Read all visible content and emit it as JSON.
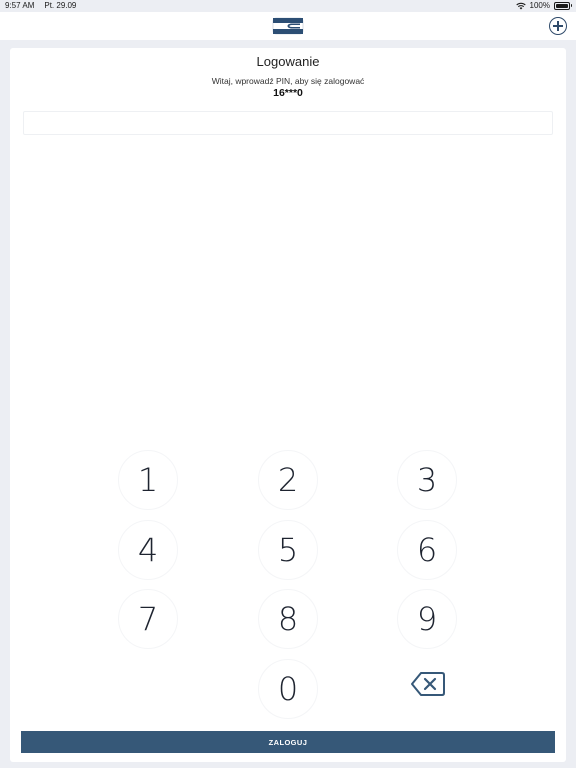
{
  "status_bar": {
    "time": "9:57 AM",
    "date": "Pt. 29.09",
    "battery": "100%"
  },
  "header": {
    "logo": "bank-logo",
    "add_icon": "plus-circle-icon"
  },
  "login": {
    "title": "Logowanie",
    "subtitle": "Witaj, wprowadź PIN, aby się zalogować",
    "masked_id": "16***0",
    "pin_value": "",
    "submit_label": "ZALOGUJ"
  },
  "keypad": {
    "keys": [
      "1",
      "2",
      "3",
      "4",
      "5",
      "6",
      "7",
      "8",
      "9",
      "0"
    ],
    "delete_icon": "backspace-icon"
  },
  "colors": {
    "accent": "#365878",
    "background": "#eceef3"
  }
}
